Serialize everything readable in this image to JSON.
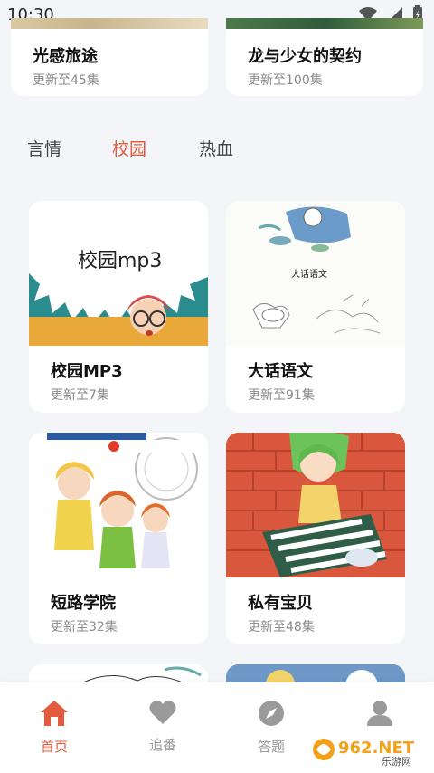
{
  "status": {
    "time": "10:30"
  },
  "top_cards": [
    {
      "title": "光感旅途",
      "subtitle": "更新至45集"
    },
    {
      "title": "龙与少女的契约",
      "subtitle": "更新至100集"
    }
  ],
  "tabs": [
    {
      "label": "言情"
    },
    {
      "label": "校园"
    },
    {
      "label": "热血"
    }
  ],
  "cards": [
    {
      "title": "校园MP3",
      "subtitle": "更新至7集",
      "cover_text": "校园mp3"
    },
    {
      "title": "大话语文",
      "subtitle": "更新至91集",
      "cover_text": "大话语文"
    },
    {
      "title": "短路学院",
      "subtitle": "更新至32集"
    },
    {
      "title": "私有宝贝",
      "subtitle": "更新至48集"
    }
  ],
  "bottom_nav": [
    {
      "label": "首页",
      "icon": "home-icon"
    },
    {
      "label": "追番",
      "icon": "heart-icon"
    },
    {
      "label": "答题",
      "icon": "compass-icon"
    },
    {
      "label": "我的",
      "icon": "user-icon"
    }
  ],
  "watermark": {
    "text": "962.NET",
    "sub": "乐游网"
  },
  "colors": {
    "accent": "#e35a3e",
    "background": "#f4f5f8",
    "muted": "#9a9a9a"
  }
}
